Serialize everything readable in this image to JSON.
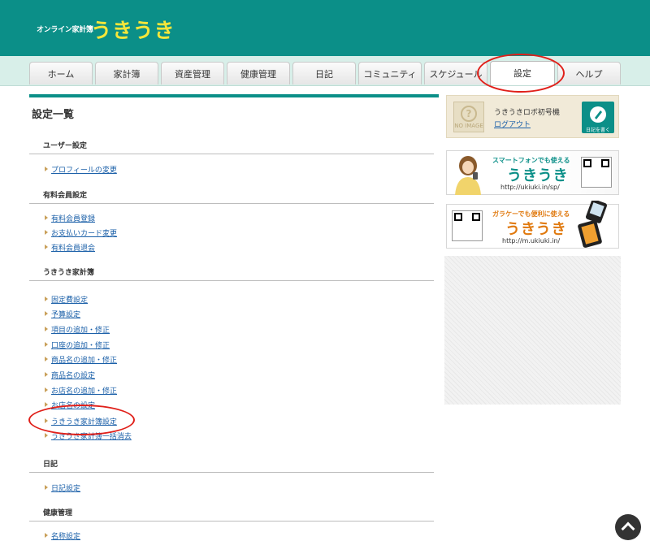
{
  "header": {
    "brand_sub": "オンライン家計簿",
    "brand_main": "うきうき"
  },
  "tabs": [
    {
      "label": "ホーム",
      "active": false
    },
    {
      "label": "家計簿",
      "active": false
    },
    {
      "label": "資産管理",
      "active": false
    },
    {
      "label": "健康管理",
      "active": false
    },
    {
      "label": "日記",
      "active": false
    },
    {
      "label": "コミュニティ",
      "active": false
    },
    {
      "label": "スケジュール",
      "active": false
    },
    {
      "label": "設定",
      "active": true
    },
    {
      "label": "ヘルプ",
      "active": false
    }
  ],
  "main": {
    "title": "設定一覧",
    "sections": [
      {
        "heading": "ユーザー設定",
        "links": [
          "プロフィールの変更"
        ]
      },
      {
        "heading": "有料会員設定",
        "links": [
          "有料会員登録",
          "お支払いカード変更",
          "有料会員退会"
        ]
      },
      {
        "heading": "うきうき家計簿",
        "links": [
          "固定費設定",
          "予算設定",
          "項目の追加・修正",
          "口座の追加・修正",
          "商品名の追加・修正",
          "商品名の設定",
          "お店名の追加・修正",
          "お店名の設定",
          "うきうき家計簿設定",
          "うきうき家計簿一括消去"
        ]
      },
      {
        "heading": "日記",
        "links": [
          "日記設定"
        ]
      },
      {
        "heading": "健康管理",
        "links": [
          "名称設定"
        ]
      }
    ]
  },
  "sidebar": {
    "profile": {
      "noimage_label": "NO IMAGE",
      "username": "うきうきロボ初号機",
      "logout": "ログアウト",
      "diary_button": "日記を書く"
    },
    "banner_smartphone": {
      "top": "スマートフォンでも使える",
      "big": "うきうき",
      "url": "http://ukiuki.in/sp/"
    },
    "banner_feature_phone": {
      "top": "ガラケーでも便利に使える",
      "big": "うきうき",
      "url": "http://m.ukiuki.in/"
    }
  },
  "colors": {
    "brand": "#0b8f88",
    "brand_text": "#f5e63a",
    "link": "#1a5fa8",
    "highlight": "#e0201a"
  }
}
